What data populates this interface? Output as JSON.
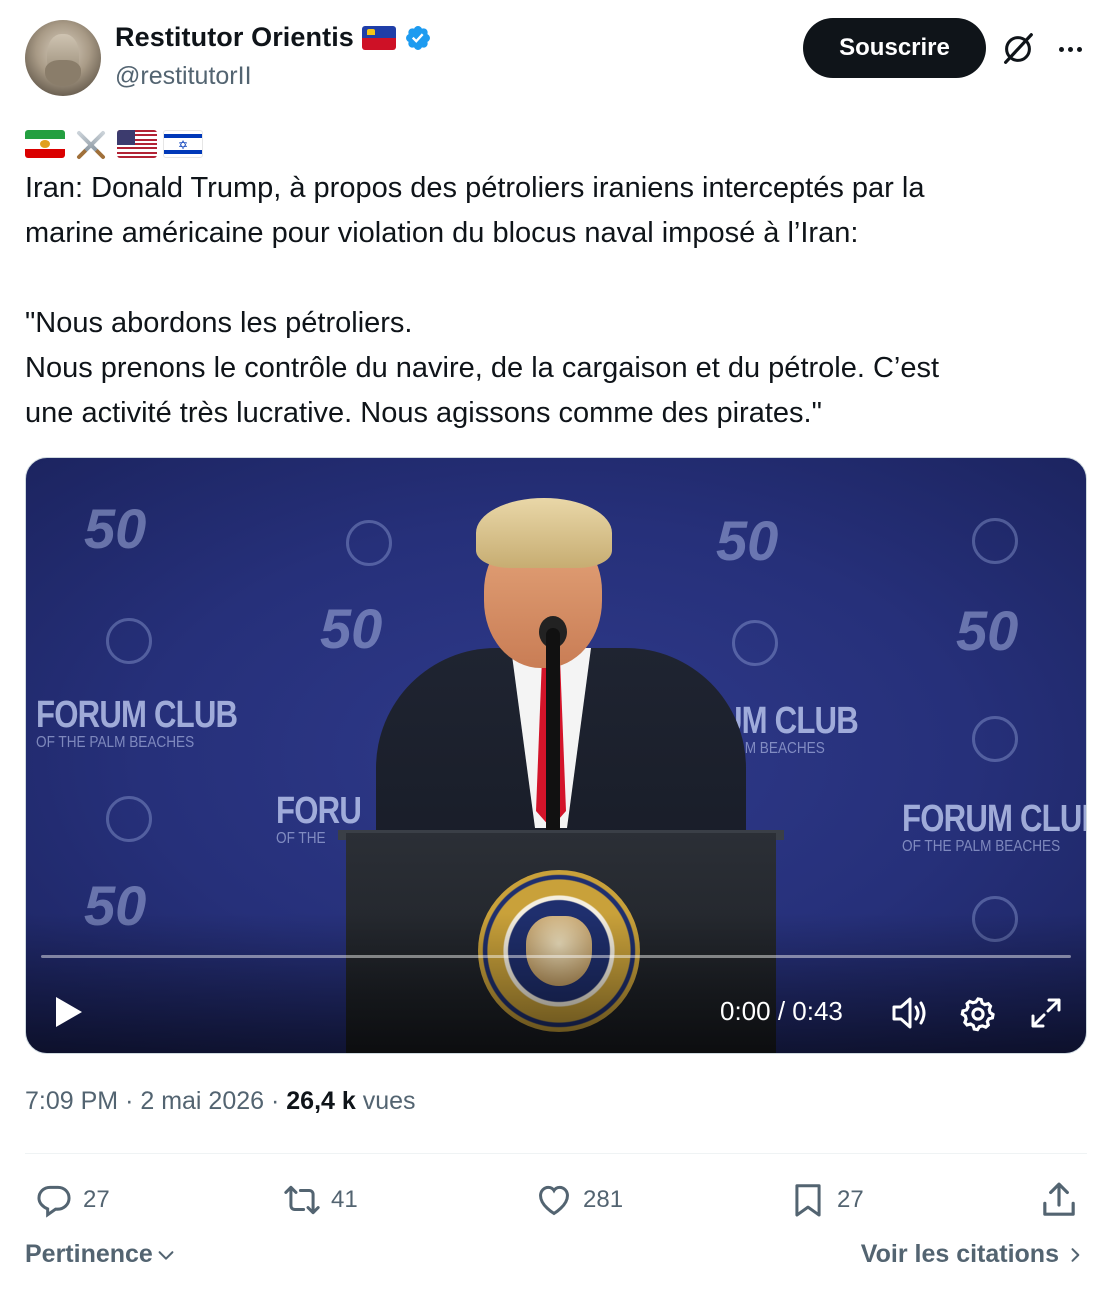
{
  "author": {
    "display_name": "Restitutor Orientis",
    "handle": "@restitutorII",
    "verified": true,
    "flag_icon": "liechtenstein-flag-icon"
  },
  "header": {
    "subscribe_label": "Souscrire",
    "grok_icon": "grok-icon",
    "more_icon": "more-options-icon"
  },
  "tweet": {
    "emoji_line": [
      "iran-flag-icon",
      "crossed-swords-icon",
      "us-flag-icon",
      "israel-flag-icon"
    ],
    "text": "Iran: Donald Trump, à propos des pétroliers iraniens interceptés par la\nmarine américaine pour violation du blocus naval imposé à l’Iran:\n\n\"Nous abordons les pétroliers.\nNous prenons le contrôle du navire, de la cargaison et du pétrole. C’est\nune activité très lucrative. Nous agissons comme des pirates.\""
  },
  "video": {
    "time_display": "0:00 / 0:43",
    "progress": 0,
    "backdrop": {
      "brand_main": "FORUM CLUB",
      "brand_sub": "OF THE PALM BEACHES",
      "brand_cut_1": "UM CLUB",
      "brand_cut_2": "PALM BEACHES",
      "brand_cut_3": "FORU",
      "brand_cut_4": "OF THE",
      "anniversary": "50"
    }
  },
  "meta": {
    "time": "7:09 PM",
    "separator": "·",
    "date": "2 mai 2026",
    "views_count": "26,4 k",
    "views_label": "vues"
  },
  "actions": {
    "replies": "27",
    "reposts": "41",
    "likes": "281",
    "bookmarks": "27"
  },
  "footer": {
    "sort_label": "Pertinence",
    "quotes_label": "Voir les citations"
  },
  "colors": {
    "text_primary": "#0f1419",
    "text_secondary": "#536471",
    "verified_blue": "#1d9bf0",
    "subscribe_bg": "#0f1419",
    "divider": "#eff3f4"
  }
}
